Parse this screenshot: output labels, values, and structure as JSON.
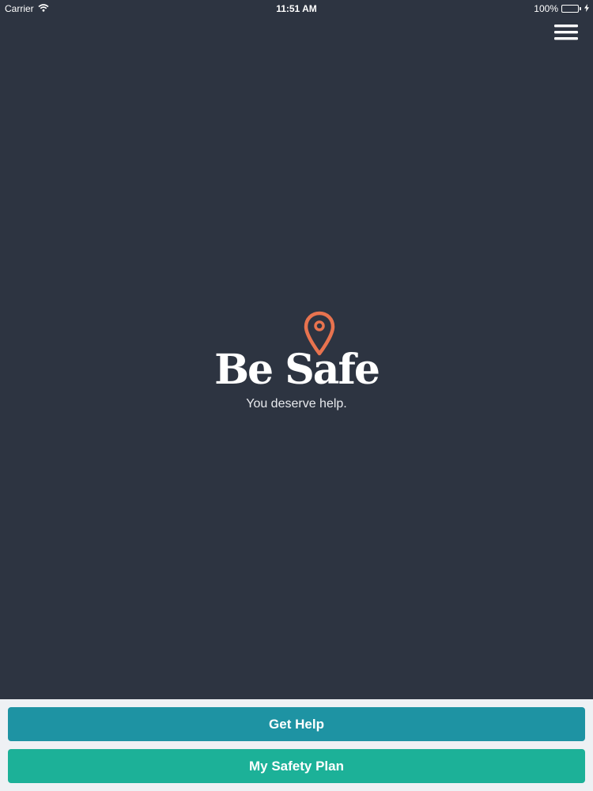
{
  "status_bar": {
    "carrier": "Carrier",
    "time": "11:51 AM",
    "battery": "100%",
    "battery_level": 1.0
  },
  "app": {
    "brand": "Be Safe",
    "tagline": "You deserve help.",
    "menu_icon": "hamburger-menu-icon",
    "pin_icon": "map-pin-icon"
  },
  "actions": {
    "get_help_label": "Get Help",
    "safety_plan_label": "My Safety Plan"
  },
  "colors": {
    "background": "#2d3441",
    "accent_pin": "#e8734f",
    "get_help": "#1e93a3",
    "safety_plan": "#1cb198",
    "bottom_bar": "#eef1f4"
  }
}
